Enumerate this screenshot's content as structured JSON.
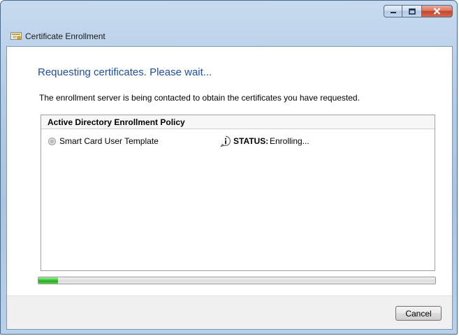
{
  "window": {
    "title": "Certificate Enrollment",
    "controls": {
      "minimize_icon": "minimize-icon",
      "maximize_icon": "maximize-icon",
      "close_icon": "close-icon"
    }
  },
  "main": {
    "heading": "Requesting certificates. Please wait...",
    "description": "The enrollment server is being contacted to obtain the certificates you have requested."
  },
  "policy_panel": {
    "title": "Active Directory Enrollment Policy",
    "template": {
      "name": "Smart Card User Template",
      "status_label": "STATUS:",
      "status_value": "Enrolling...",
      "status_icon": "info-icon"
    }
  },
  "progress": {
    "fraction": 0.05
  },
  "footer": {
    "cancel_label": "Cancel"
  },
  "colors": {
    "heading": "#1f4fa0",
    "progress_fill": "#3cc036",
    "window_frame": "#b2cbe6"
  }
}
